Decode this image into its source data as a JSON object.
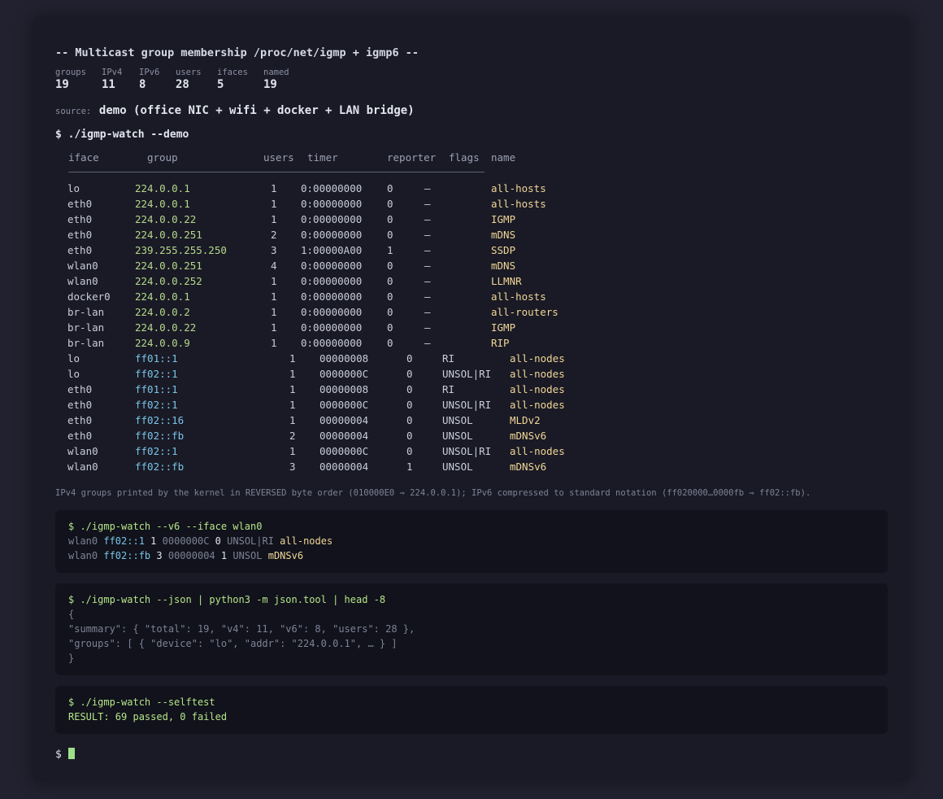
{
  "title": "-- Multicast group membership /proc/net/igmp + igmp6 --",
  "stats": [
    {
      "label": "groups",
      "value": "19"
    },
    {
      "label": "IPv4",
      "value": "11"
    },
    {
      "label": "IPv6",
      "value": "8"
    },
    {
      "label": "users",
      "value": "28"
    },
    {
      "label": "ifaces",
      "value": "5"
    },
    {
      "label": "named",
      "value": "19"
    }
  ],
  "source": {
    "label": "source:",
    "value": "demo (office NIC + wifi + docker + LAN bridge)"
  },
  "command": "$ ./igmp-watch --demo",
  "table": {
    "headers": [
      "iface",
      "group",
      "users",
      "timer",
      "reporter",
      "flags",
      "name"
    ],
    "rows_v4": [
      [
        "lo",
        "224.0.0.1",
        "1",
        "0:00000000",
        "0",
        "–",
        "all-hosts"
      ],
      [
        "eth0",
        "224.0.0.1",
        "1",
        "0:00000000",
        "0",
        "–",
        "all-hosts"
      ],
      [
        "eth0",
        "224.0.0.22",
        "1",
        "0:00000000",
        "0",
        "–",
        "IGMP"
      ],
      [
        "eth0",
        "224.0.0.251",
        "2",
        "0:00000000",
        "0",
        "–",
        "mDNS"
      ],
      [
        "eth0",
        "239.255.255.250",
        "3",
        "1:00000A00",
        "1",
        "–",
        "SSDP"
      ],
      [
        "wlan0",
        "224.0.0.251",
        "4",
        "0:00000000",
        "0",
        "–",
        "mDNS"
      ],
      [
        "wlan0",
        "224.0.0.252",
        "1",
        "0:00000000",
        "0",
        "–",
        "LLMNR"
      ],
      [
        "docker0",
        "224.0.0.1",
        "1",
        "0:00000000",
        "0",
        "–",
        "all-hosts"
      ],
      [
        "br-lan",
        "224.0.0.2",
        "1",
        "0:00000000",
        "0",
        "–",
        "all-routers"
      ],
      [
        "br-lan",
        "224.0.0.22",
        "1",
        "0:00000000",
        "0",
        "–",
        "IGMP"
      ],
      [
        "br-lan",
        "224.0.0.9",
        "1",
        "0:00000000",
        "0",
        "–",
        "RIP"
      ]
    ],
    "rows_v6": [
      [
        "lo",
        "ff01::1",
        "1",
        "00000008",
        "0",
        "RI",
        "all-nodes"
      ],
      [
        "lo",
        "ff02::1",
        "1",
        "0000000C",
        "0",
        "UNSOL|RI",
        "all-nodes"
      ],
      [
        "eth0",
        "ff01::1",
        "1",
        "00000008",
        "0",
        "RI",
        "all-nodes"
      ],
      [
        "eth0",
        "ff02::1",
        "1",
        "0000000C",
        "0",
        "UNSOL|RI",
        "all-nodes"
      ],
      [
        "eth0",
        "ff02::16",
        "1",
        "00000004",
        "0",
        "UNSOL",
        "MLDv2"
      ],
      [
        "eth0",
        "ff02::fb",
        "2",
        "00000004",
        "0",
        "UNSOL",
        "mDNSv6"
      ],
      [
        "wlan0",
        "ff02::1",
        "1",
        "0000000C",
        "0",
        "UNSOL|RI",
        "all-nodes"
      ],
      [
        "wlan0",
        "ff02::fb",
        "3",
        "00000004",
        "1",
        "UNSOL",
        "mDNSv6"
      ]
    ]
  },
  "note": "IPv4 groups printed by the kernel in REVERSED byte order (010000E0 ⇒ 224.0.0.1); IPv6 compressed to standard notation (ff020000…0000fb ⇒ ff02::fb).",
  "box_v6": {
    "command": "$ ./igmp-watch --v6 --iface wlan0",
    "lines": [
      {
        "iface": "wlan0",
        "addr": "ff02::1",
        "users": "1",
        "timer": "0000000C",
        "reporter": "0",
        "flags": "UNSOL|RI",
        "name": "all-nodes"
      },
      {
        "iface": "wlan0",
        "addr": "ff02::fb",
        "users": "3",
        "timer": "00000004",
        "reporter": "1",
        "flags": "UNSOL",
        "name": "mDNSv6"
      }
    ]
  },
  "box_json": {
    "command": "$ ./igmp-watch --json | python3 -m json.tool | head -8",
    "lines": [
      "{",
      "\"summary\": { \"total\": 19, \"v4\": 11, \"v6\": 8, \"users\": 28 },",
      "\"groups\": [ { \"device\": \"lo\", \"addr\": \"224.0.0.1\", … } ]",
      "}"
    ]
  },
  "box_test": {
    "command": "$ ./igmp-watch --selftest",
    "result": "RESULT: 69 passed, 0 failed"
  },
  "prompt": "$"
}
